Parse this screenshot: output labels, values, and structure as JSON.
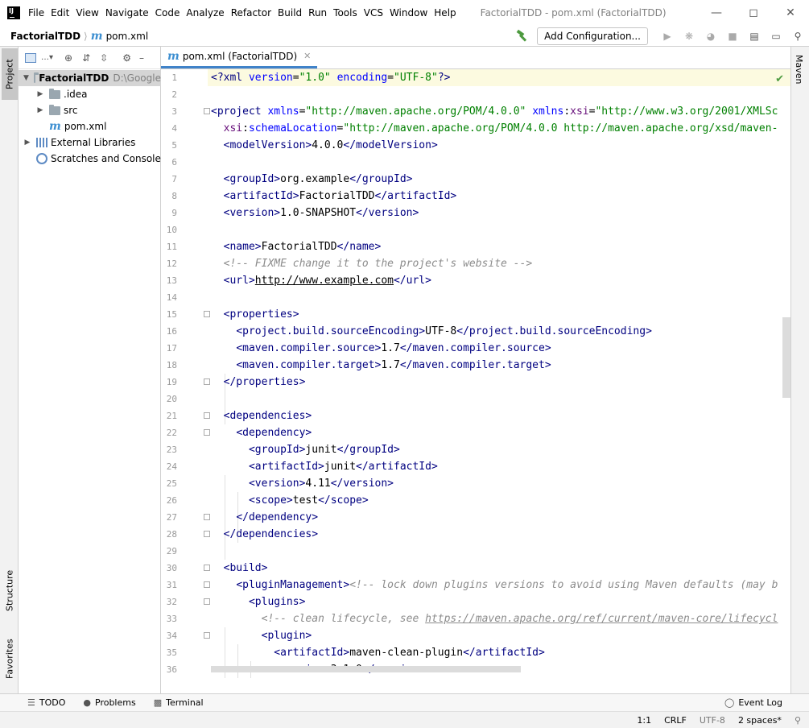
{
  "window": {
    "title": "FactorialTDD - pom.xml (FactorialTDD)",
    "menu": [
      "File",
      "Edit",
      "View",
      "Navigate",
      "Code",
      "Analyze",
      "Refactor",
      "Build",
      "Run",
      "Tools",
      "VCS",
      "Window",
      "Help"
    ]
  },
  "navbar": {
    "project": "FactorialTDD",
    "file": "pom.xml",
    "add_configuration": "Add Configuration..."
  },
  "sidebar_tabs": {
    "project": "Project",
    "structure": "Structure",
    "favorites": "Favorites",
    "maven": "Maven"
  },
  "project_tree": {
    "root_name": "FactorialTDD",
    "root_path": "D:\\Google",
    "items": [
      {
        "label": ".idea",
        "icon": "folder-icon"
      },
      {
        "label": "src",
        "icon": "folder-icon"
      },
      {
        "label": "pom.xml",
        "icon": "maven-file-icon"
      },
      {
        "label": "External Libraries",
        "icon": "libraries-icon"
      },
      {
        "label": "Scratches and Consoles",
        "icon": "scratches-icon"
      }
    ]
  },
  "editor": {
    "tab_label": "pom.xml (FactorialTDD)",
    "line_numbers": [
      "1",
      "2",
      "3",
      "4",
      "5",
      "6",
      "7",
      "8",
      "9",
      "10",
      "11",
      "12",
      "13",
      "14",
      "15",
      "16",
      "17",
      "18",
      "19",
      "20",
      "21",
      "22",
      "23",
      "24",
      "25",
      "26",
      "27",
      "28",
      "29",
      "30",
      "31",
      "32",
      "33",
      "34",
      "35",
      "36"
    ]
  },
  "bottom_tabs": {
    "todo": "TODO",
    "problems": "Problems",
    "terminal": "Terminal",
    "event_log": "Event Log"
  },
  "status": {
    "position": "1:1",
    "line_separator": "CRLF",
    "encoding": "UTF-8",
    "indent": "2 spaces*"
  },
  "colors": {
    "tag": "#000080",
    "attribute": "#0000ff",
    "value": "#008000",
    "namespace": "#660e7a",
    "comment": "#8c8c8c",
    "current_line": "#fcfae0"
  }
}
